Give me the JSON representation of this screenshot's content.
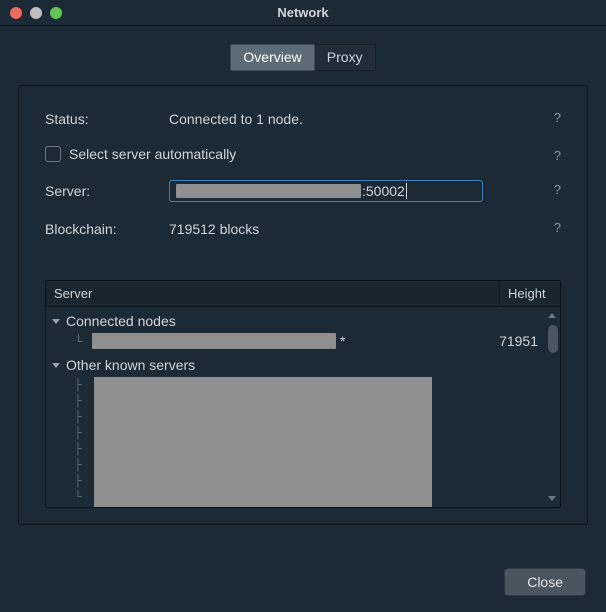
{
  "window": {
    "title": "Network"
  },
  "tabs": {
    "overview": "Overview",
    "proxy": "Proxy"
  },
  "form": {
    "status_label": "Status:",
    "status_value": "Connected to 1 node.",
    "auto_label": "Select server automatically",
    "auto_checked": false,
    "server_label": "Server:",
    "server_port": ":50002",
    "blockchain_label": "Blockchain:",
    "blockchain_value": "719512 blocks",
    "help": "?"
  },
  "table": {
    "headers": {
      "server": "Server",
      "height": "Height"
    },
    "groups": {
      "connected": "Connected nodes",
      "other": "Other known servers"
    },
    "connected_item": {
      "height": "71951"
    },
    "star": "*"
  },
  "footer": {
    "close": "Close"
  }
}
